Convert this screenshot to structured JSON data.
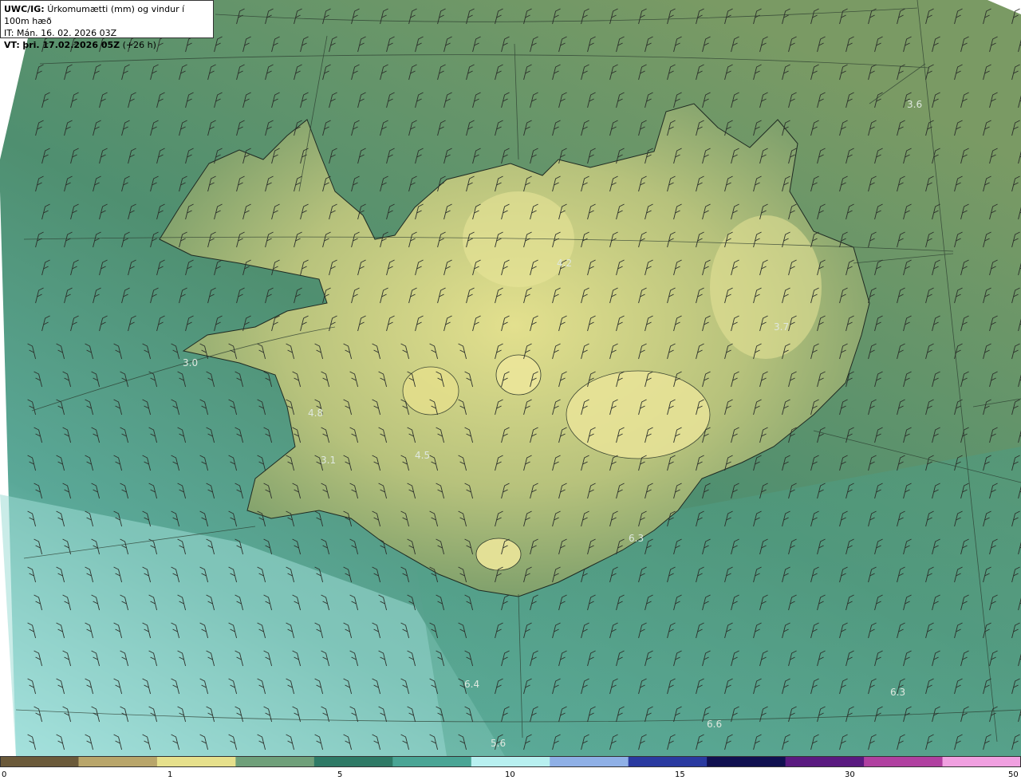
{
  "header": {
    "product": "UWC/IG:",
    "title": "Úrkomumætti (mm) og vindur í 100m hæð",
    "initial_time": "IT: Mán. 16. 02. 2026 03Z",
    "valid_prefix": "VT:",
    "valid_time": "þri. 17.02.2026 05Z",
    "valid_offset": "(+26 h)"
  },
  "value_labels": [
    {
      "text": "3.6"
    },
    {
      "text": "4.2"
    },
    {
      "text": "3.7"
    },
    {
      "text": "3.0"
    },
    {
      "text": "4.8"
    },
    {
      "text": "3.1"
    },
    {
      "text": "4.5"
    },
    {
      "text": "6.3"
    },
    {
      "text": "6.4"
    },
    {
      "text": "6.3"
    },
    {
      "text": "6.6"
    },
    {
      "text": "5.6"
    }
  ],
  "colorbar": {
    "ticks": [
      "0",
      "1",
      "5",
      "10",
      "15",
      "30",
      "50"
    ],
    "colors": [
      "#6b5a3a",
      "#b8a56a",
      "#e6e08c",
      "#6fa07a",
      "#2e7a66",
      "#4aa595",
      "#b8f0f0",
      "#8fb0e6",
      "#2a3aa0",
      "#101050",
      "#5a1a80",
      "#b040a0",
      "#f0a0e0"
    ]
  }
}
